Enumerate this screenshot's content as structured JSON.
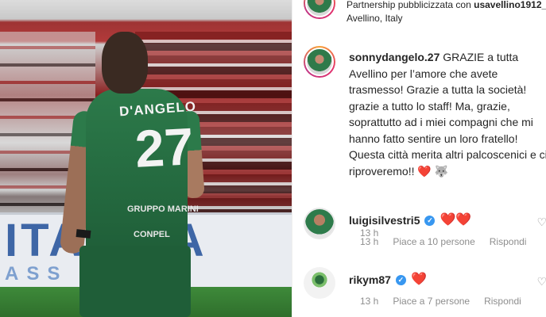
{
  "post": {
    "author": "sonnydangelo.27",
    "partnership_label": "Partnership pubblicizzata con",
    "partner": "usavellino1912_",
    "location": "Avellino, Italy",
    "caption": "GRAZIE a tutta Avellino per l’amore che avete trasmesso! Grazie a tutta la società! grazie a tutto lo staff! Ma, grazie, soprattutto ad i miei compagni che mi hanno fatto sentire un loro fratello! Questa città merita altri palcoscenici e ci riproveremo!!",
    "caption_emojis": "❤️ 🐺",
    "time": "13 h"
  },
  "photo": {
    "jersey_name": "D'ANGELO",
    "jersey_number": "27",
    "sponsor_1": "GRUPPO MARINI",
    "sponsor_2": "CONPEL",
    "banner_text": "ITA  ANA",
    "banner_sub": "ASS   IONI"
  },
  "comments": [
    {
      "username": "luigisilvestri5",
      "verified": true,
      "text": "❤️❤️",
      "time": "13 h",
      "likes": "Piace a 10 persone",
      "reply": "Rispondi"
    },
    {
      "username": "rikym87",
      "verified": true,
      "text": "❤️",
      "time": "13 h",
      "likes": "Piace a 7 persone",
      "reply": "Rispondi"
    }
  ],
  "icons": {
    "verified": "verified-badge-icon",
    "like": "heart-outline-icon"
  },
  "colors": {
    "verified": "#3897f0",
    "heart": "#ed4956",
    "muted": "#8e8e8e",
    "text": "#262626"
  }
}
